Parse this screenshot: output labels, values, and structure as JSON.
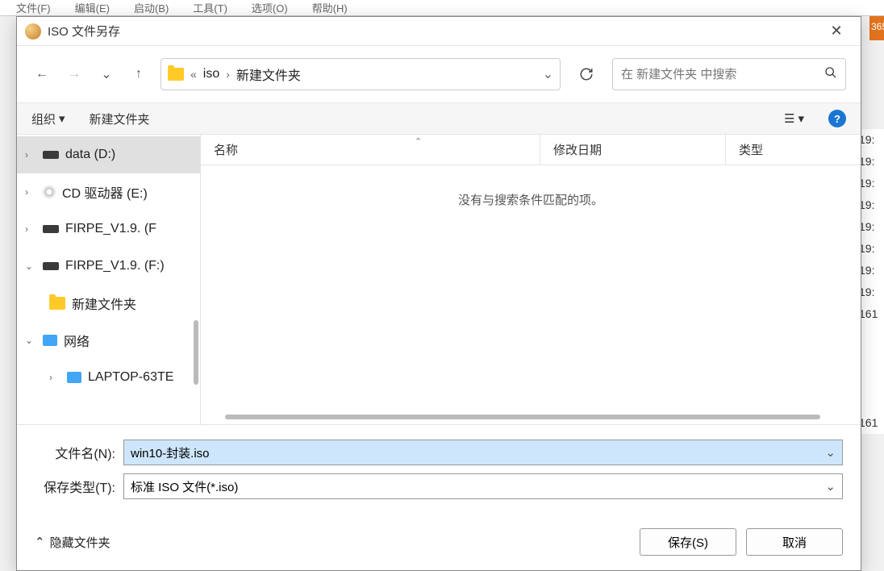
{
  "bgMenubar": [
    "文件(F)",
    "编辑(E)",
    "启动(B)",
    "工具(T)",
    "选项(O)",
    "帮助(H)"
  ],
  "bgOrange": "365",
  "bgTimes": [
    "19:",
    "19:",
    "19:",
    "19:",
    "19:",
    "19:",
    "19:",
    "19:",
    "161",
    "",
    "",
    "",
    "",
    "161"
  ],
  "title": "ISO 文件另存",
  "breadcrumb": {
    "prefix": "«",
    "items": [
      "iso",
      "新建文件夹"
    ]
  },
  "searchPlaceholder": "在 新建文件夹 中搜索",
  "toolbar": {
    "organize": "组织",
    "newFolder": "新建文件夹"
  },
  "tree": [
    {
      "label": "data (D:)",
      "icon": "drive",
      "chev": "›",
      "selected": true
    },
    {
      "label": "CD 驱动器 (E:)",
      "icon": "cd",
      "chev": "›"
    },
    {
      "label": "FIRPE_V1.9. (F",
      "icon": "drive",
      "chev": "›"
    },
    {
      "label": "FIRPE_V1.9. (F:)",
      "icon": "drive",
      "chev": "⌄"
    },
    {
      "label": "新建文件夹",
      "icon": "folder",
      "child": true
    },
    {
      "label": "网络",
      "icon": "net",
      "chev": "⌄"
    },
    {
      "label": "LAPTOP-63TE",
      "icon": "comp",
      "chev": "›",
      "child": true
    }
  ],
  "headers": {
    "name": "名称",
    "date": "修改日期",
    "type": "类型"
  },
  "emptyMsg": "没有与搜索条件匹配的项。",
  "filenameLabel": "文件名(N):",
  "filenameValue": "win10-封装.iso",
  "filetypeLabel": "保存类型(T):",
  "filetypeValue": "标准 ISO 文件(*.iso)",
  "hideFolders": "隐藏文件夹",
  "saveBtn": "保存(S)",
  "cancelBtn": "取消"
}
